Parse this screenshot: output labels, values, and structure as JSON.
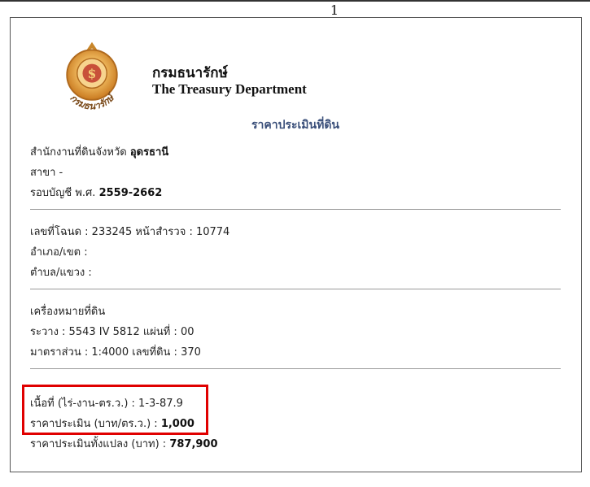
{
  "page_number": "1",
  "header": {
    "org_thai": "กรมธนารักษ์",
    "org_english": "The Treasury Department",
    "seal_text": "กรมธนารักษ์"
  },
  "document_title": "ราคาประเมินที่ดิน",
  "office": {
    "label": "สำนักงานที่ดินจังหวัด",
    "province": "อุดรธานี",
    "branch": "สาขา -",
    "fiscal_label": "รอบบัญชี พ.ศ.",
    "fiscal_years": "2559-2662"
  },
  "deed": {
    "number_line": "เลขที่โฉนด : 233245 หน้าสำรวจ : 10774",
    "district_line": "อำเภอ/เขต :",
    "subdistrict_line": "ตำบล/แขวง :"
  },
  "landmark": {
    "heading": "เครื่องหมายที่ดิน",
    "grid_line": "ระวาง : 5543 IV 5812 แผ่นที่ : 00",
    "scale_line": "มาตราส่วน : 1:4000 เลขที่ดิน : 370"
  },
  "valuation": {
    "area_line": "เนื้อที่ (ไร่-งาน-ตร.ว.) : 1-3-87.9",
    "price_label": "ราคาประเมิน (บาท/ตร.ว.) :",
    "price_value": "1,000",
    "total_label": "ราคาประเมินทั้งแปลง (บาท) :",
    "total_value": "787,900"
  },
  "colors": {
    "title": "#3a4f7a",
    "highlight": "#e00000",
    "seal_gold": "#e0a030"
  }
}
